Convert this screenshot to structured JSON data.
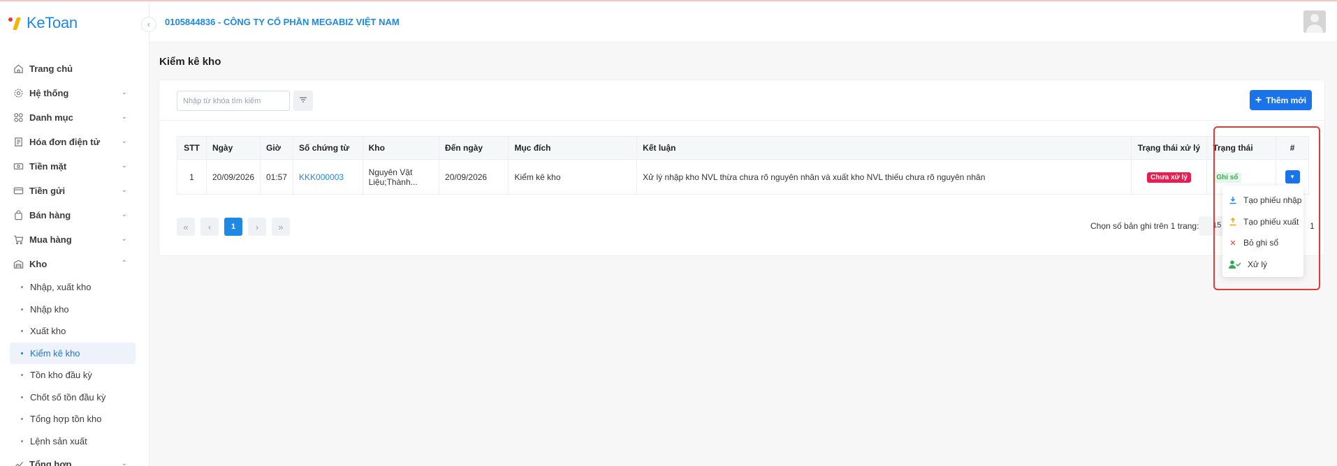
{
  "app": {
    "logo_text": "KeToan"
  },
  "header": {
    "company": "0105844836 - CÔNG TY CỔ PHẦN MEGABIZ VIỆT NAM"
  },
  "sidebar": {
    "items": [
      {
        "label": "Trang chủ",
        "icon": "home-icon"
      },
      {
        "label": "Hệ thống",
        "icon": "gear-icon"
      },
      {
        "label": "Danh mục",
        "icon": "grid-icon"
      },
      {
        "label": "Hóa đơn điện tử",
        "icon": "invoice-icon"
      },
      {
        "label": "Tiền mặt",
        "icon": "cash-icon"
      },
      {
        "label": "Tiền gửi",
        "icon": "bank-card-icon"
      },
      {
        "label": "Bán hàng",
        "icon": "shopping-bag-icon"
      },
      {
        "label": "Mua hàng",
        "icon": "cart-icon"
      },
      {
        "label": "Kho",
        "icon": "warehouse-icon"
      },
      {
        "label": "Tổng hợp",
        "icon": "chart-line-icon"
      }
    ],
    "kho_sub": [
      "Nhập, xuất kho",
      "Nhập kho",
      "Xuất kho",
      "Kiểm kê kho",
      "Tồn kho đầu kỳ",
      "Chốt số tồn đầu kỳ",
      "Tổng hợp tồn kho",
      "Lệnh sản xuất"
    ],
    "active_sub": "Kiểm kê kho"
  },
  "page": {
    "title": "Kiểm kê kho"
  },
  "toolbar": {
    "search_placeholder": "Nhập từ khóa tìm kiếm",
    "add_label": "Thêm mới"
  },
  "table": {
    "headers": [
      "STT",
      "Ngày",
      "Giờ",
      "Số chứng từ",
      "Kho",
      "Đến ngày",
      "Mục đích",
      "Kết luận",
      "Trạng thái xử lý",
      "Trạng thái",
      "#"
    ],
    "rows": [
      {
        "stt": "1",
        "ngay": "20/09/2026",
        "gio": "01:57",
        "so_chung_tu": "KKK000003",
        "kho_line1": "Nguyên Vật",
        "kho_line2": "Liệu;Thành...",
        "den_ngay": "20/09/2026",
        "muc_dich": "Kiểm kê kho",
        "ket_luan": "Xử lý nhập kho NVL thừa chưa rõ nguyên nhân và xuất kho NVL thiếu chưa rõ nguyên nhân",
        "trang_thai_xu_ly": "Chưa xử lý",
        "trang_thai": "Ghi sổ"
      }
    ]
  },
  "pagination": {
    "current_page": "1",
    "per_page_label": "Chọn số bản ghi trên 1 trang:",
    "per_page_value": "15",
    "total": "1"
  },
  "row_menu": {
    "items": [
      {
        "label": "Tạo phiếu nhập",
        "icon": "download-icon",
        "color": "#1e88e5"
      },
      {
        "label": "Tạo phiếu xuất",
        "icon": "upload-icon",
        "color": "#f4a100"
      },
      {
        "label": "Bỏ ghi sổ",
        "icon": "close-icon",
        "color": "#e53935"
      },
      {
        "label": "Xử lý",
        "icon": "user-check-icon",
        "color": "#34a853"
      }
    ]
  },
  "colors": {
    "primary": "#1a73e8",
    "danger": "#e91e50",
    "success": "#3aa757",
    "highlight": "#e53935"
  }
}
